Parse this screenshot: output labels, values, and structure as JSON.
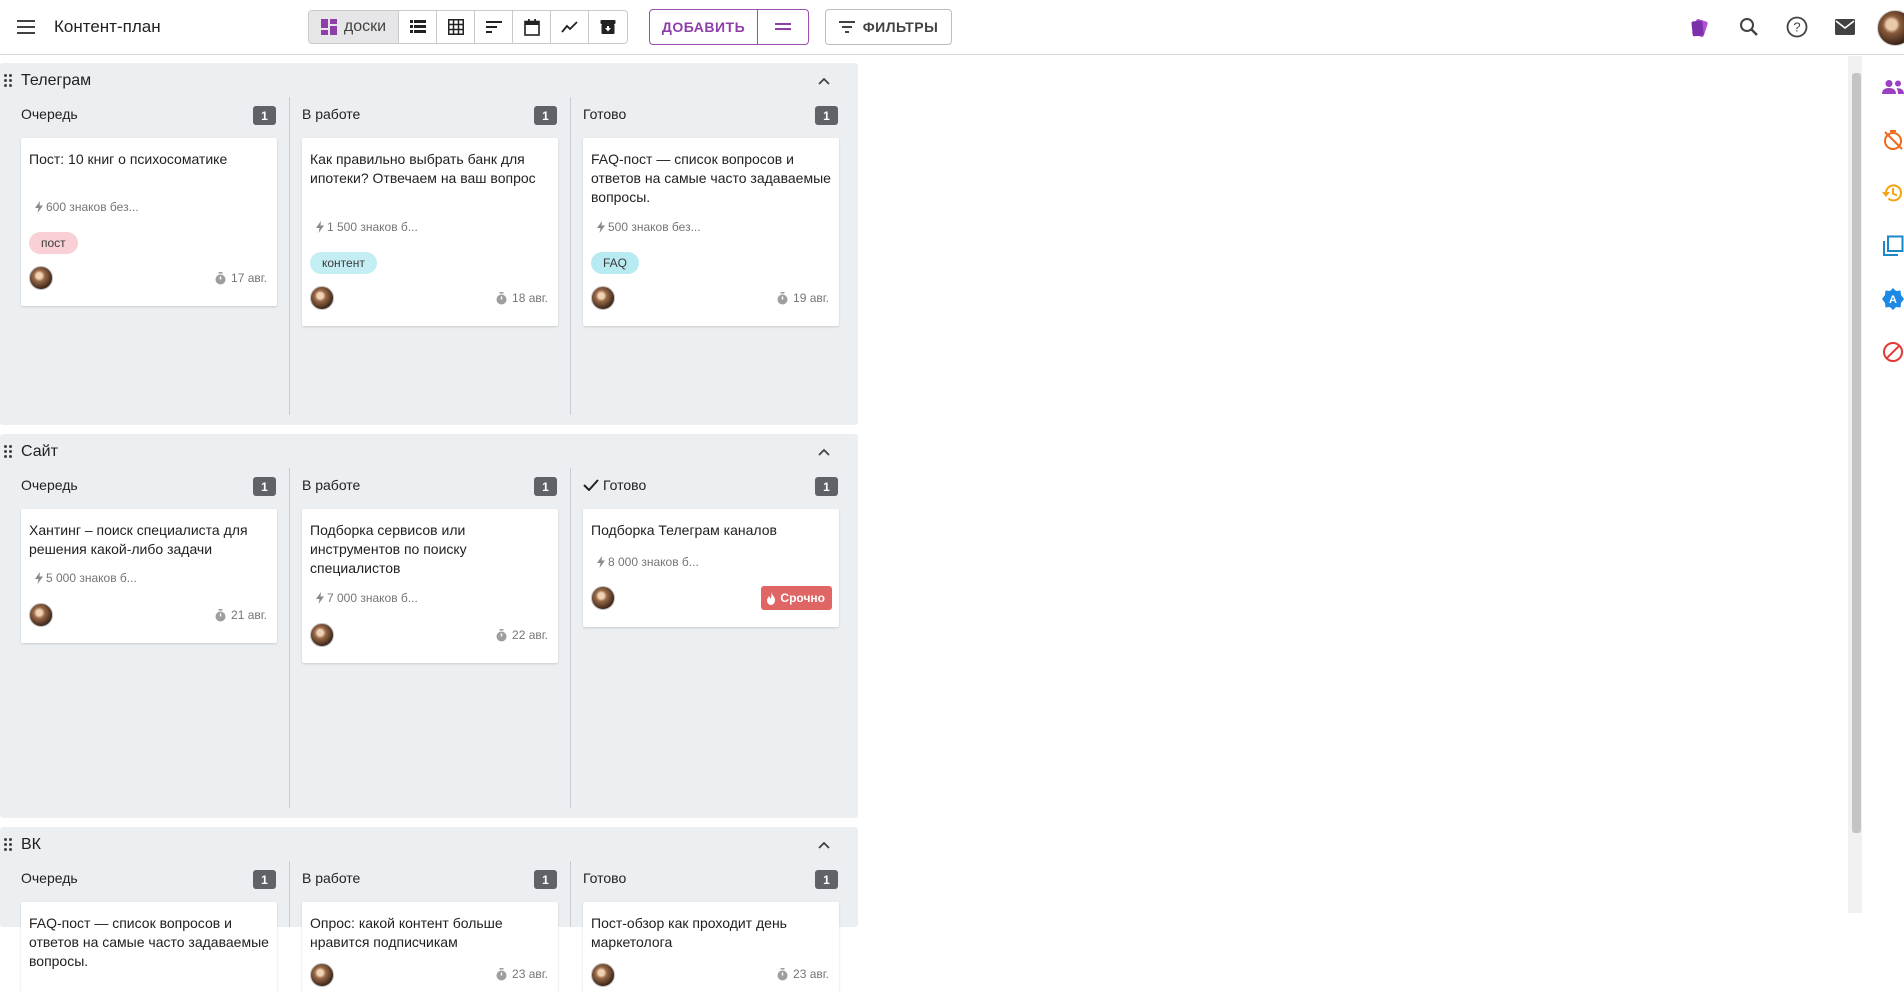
{
  "app": {
    "title": "Контент-план"
  },
  "toolbar": {
    "view_active_label": "доски",
    "add_label": "ДОБАВИТЬ",
    "filters_label": "ФИЛЬТРЫ"
  },
  "colors": {
    "accent": "#8e3ea8",
    "board_bg": "#eceff1",
    "count_badge": "#5f6368",
    "tag_post": "#f8d0d5",
    "tag_content": "#c5eef4",
    "tag_faq": "#b8eaf2",
    "urgent": "#e06666"
  },
  "boards": [
    {
      "title": "Телеграм",
      "columns": [
        {
          "title": "Очередь",
          "count": "1",
          "cards": [
            {
              "title": "Пост: 10 книг о психосоматике",
              "meta": "600 знаков без...",
              "tag": "пост",
              "date": "17 авг."
            }
          ]
        },
        {
          "title": "В работе",
          "count": "1",
          "cards": [
            {
              "title": "Как правильно выбрать банк для ипотеки? Отвечаем на ваш вопрос",
              "meta": "1 500 знаков б...",
              "tag": "контент",
              "date": "18 авг."
            }
          ]
        },
        {
          "title": "Готово",
          "count": "1",
          "cards": [
            {
              "title": "FAQ-пост — список вопросов и ответов на самые часто задаваемые вопросы.",
              "meta": "500 знаков без...",
              "tag": "FAQ",
              "date": "19 авг."
            }
          ]
        }
      ]
    },
    {
      "title": "Сайт",
      "columns": [
        {
          "title": "Очередь",
          "count": "1",
          "cards": [
            {
              "title": "Хантинг – поиск специалиста для решения какой-либо задачи",
              "meta": "5 000 знаков б...",
              "date": "21 авг."
            }
          ]
        },
        {
          "title": "В работе",
          "count": "1",
          "cards": [
            {
              "title": "Подборка сервисов или инструментов по поиску специалистов",
              "meta": "7 000 знаков б...",
              "date": "22 авг."
            }
          ]
        },
        {
          "title": "Готово",
          "count": "1",
          "cards": [
            {
              "title": "Подборка Телеграм каналов",
              "meta": "8 000 знаков б...",
              "urgent": "Срочно"
            }
          ]
        }
      ]
    },
    {
      "title": "ВК",
      "columns": [
        {
          "title": "Очередь",
          "count": "1",
          "cards": [
            {
              "title": "FAQ-пост — список вопросов и ответов на самые часто задаваемые вопросы."
            }
          ]
        },
        {
          "title": "В работе",
          "count": "1",
          "cards": [
            {
              "title": "Опрос: какой контент больше нравится подписчикам",
              "date": "23 авг."
            }
          ]
        },
        {
          "title": "Готово",
          "count": "1",
          "cards": [
            {
              "title": "Пост-обзор как проходит день маркетолога",
              "date": "23 авг."
            }
          ]
        }
      ]
    }
  ]
}
